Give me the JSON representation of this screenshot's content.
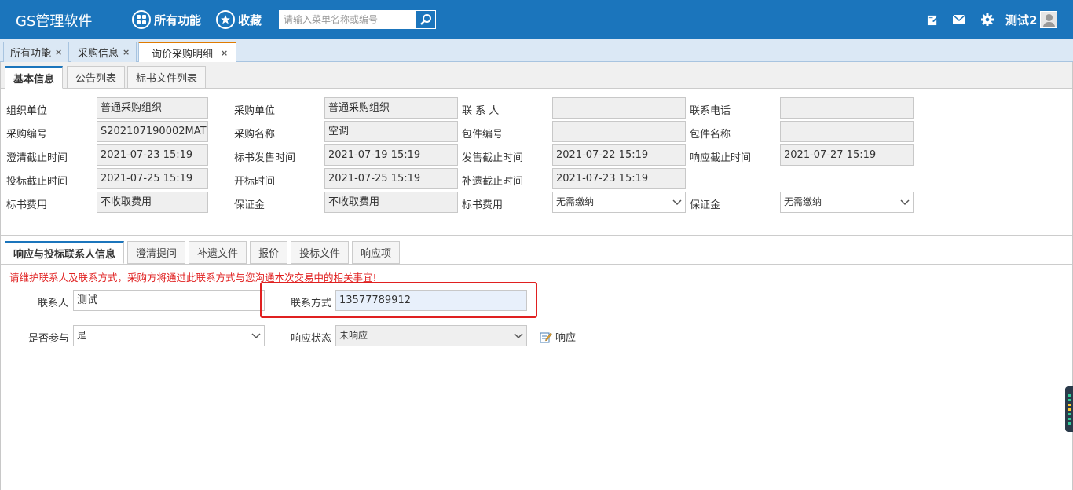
{
  "app": {
    "title": "GS管理软件"
  },
  "nav": {
    "all_functions": "所有功能",
    "favorites": "收藏"
  },
  "search": {
    "placeholder": "请输入菜单名称或编号"
  },
  "user": {
    "name": "测试2"
  },
  "page_tabs": [
    {
      "label": "所有功能",
      "close": "×"
    },
    {
      "label": "采购信息",
      "close": "×"
    },
    {
      "label": "询价采购明细",
      "close": "×"
    }
  ],
  "info_tabs": [
    "基本信息",
    "公告列表",
    "标书文件列表"
  ],
  "basic_info": {
    "org_unit": {
      "label": "组织单位",
      "value": "普通采购组织"
    },
    "purchase_unit": {
      "label": "采购单位",
      "value": "普通采购组织"
    },
    "contact": {
      "label": "联 系 人",
      "value": ""
    },
    "phone": {
      "label": "联系电话",
      "value": ""
    },
    "purchase_no": {
      "label": "采购编号",
      "value": "S202107190002MAT"
    },
    "purchase_name": {
      "label": "采购名称",
      "value": "空调"
    },
    "package_no": {
      "label": "包件编号",
      "value": ""
    },
    "package_name": {
      "label": "包件名称",
      "value": ""
    },
    "clarify_deadline": {
      "label": "澄清截止时间",
      "value": "2021-07-23 15:19"
    },
    "doc_sale_time": {
      "label": "标书发售时间",
      "value": "2021-07-19 15:19"
    },
    "sale_deadline": {
      "label": "发售截止时间",
      "value": "2021-07-22 15:19"
    },
    "response_deadline": {
      "label": "响应截止时间",
      "value": "2021-07-27 15:19"
    },
    "bid_deadline": {
      "label": "投标截止时间",
      "value": "2021-07-25 15:19"
    },
    "open_time": {
      "label": "开标时间",
      "value": "2021-07-25 15:19"
    },
    "supplement_deadline": {
      "label": "补遗截止时间",
      "value": "2021-07-23 15:19"
    },
    "doc_fee": {
      "label": "标书费用",
      "value": "不收取费用"
    },
    "deposit": {
      "label": "保证金",
      "value": "不收取费用"
    },
    "doc_fee_select": {
      "label": "标书费用",
      "value": "无需缴纳"
    },
    "deposit_select": {
      "label": "保证金",
      "value": "无需缴纳"
    }
  },
  "response_tabs": [
    "响应与投标联系人信息",
    "澄清提问",
    "补遗文件",
    "报价",
    "投标文件",
    "响应项"
  ],
  "response": {
    "notice": "请维护联系人及联系方式，采购方将通过此联系方式与您沟通本次交易中的相关事宜!",
    "contact_label": "联系人",
    "contact_value": "测试",
    "method_label": "联系方式",
    "method_value": "13577789912",
    "participate_label": "是否参与",
    "participate_value": "是",
    "status_label": "响应状态",
    "status_value": "未响应",
    "respond_button": "响应"
  },
  "colors": {
    "header": "#1b75bc",
    "notice": "#e02020",
    "highlight": "#e02020"
  }
}
